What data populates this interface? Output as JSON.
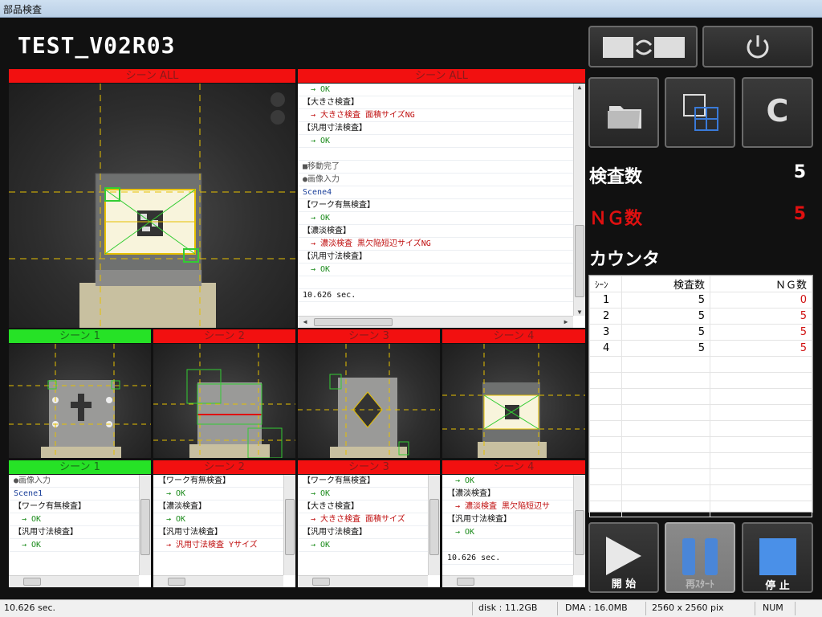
{
  "window": {
    "title": "部品検査"
  },
  "app": {
    "title": "TEST_V02R03"
  },
  "panels": {
    "top_left_header": "シーン ALL",
    "top_right_header": "シーン ALL",
    "scene_img_headers": [
      "シーン 1",
      "シーン 2",
      "シーン 3",
      "シーン 4"
    ],
    "scene_log_headers": [
      "シーン 1",
      "シーン 2",
      "シーン 3",
      "シーン 4"
    ]
  },
  "main_log": [
    "→ OK",
    "【大きさ検査】",
    "→ 大きさ検査 面積サイズNG",
    "【汎用寸法検査】",
    "→ OK",
    "",
    "■移動完了",
    "●画像入力",
    "Scene4",
    "【ワーク有無検査】",
    "→ OK",
    "【濃淡検査】",
    "→ 濃淡検査 黒欠陥短辺サイズNG",
    "【汎用寸法検査】",
    "→ OK",
    "",
    "10.626 sec."
  ],
  "scene_logs": [
    [
      "●画像入力",
      "Scene1",
      "【ワーク有無検査】",
      "→ OK",
      "【汎用寸法検査】",
      "→ OK"
    ],
    [
      "【ワーク有無検査】",
      "→ OK",
      "【濃淡検査】",
      "→ OK",
      "【汎用寸法検査】",
      "→ 汎用寸法検査 Yサイズ"
    ],
    [
      "【ワーク有無検査】",
      "→ OK",
      "【大きさ検査】",
      "→ 大きさ検査 面積サイズ",
      "【汎用寸法検査】",
      "→ OK"
    ],
    [
      "→ OK",
      "【濃淡検査】",
      "→ 濃淡検査 黒欠陥短辺サ",
      "【汎用寸法検査】",
      "→ OK",
      "",
      "10.626 sec."
    ]
  ],
  "stats": {
    "inspect_label": "検査数",
    "inspect_value": "5",
    "ng_label": "ＮＧ数",
    "ng_value": "5",
    "counter_label": "カウンタ"
  },
  "counter_table": {
    "headers": [
      "ｼｰﾝ",
      "検査数",
      "ＮＧ数"
    ],
    "rows": [
      [
        "1",
        "5",
        "0"
      ],
      [
        "2",
        "5",
        "5"
      ],
      [
        "3",
        "5",
        "5"
      ],
      [
        "4",
        "5",
        "5"
      ]
    ]
  },
  "buttons": {
    "start": "開 始",
    "restart": "再ｽﾀｰﾄ",
    "stop": "停 止",
    "clear": "C"
  },
  "status": {
    "time": "10.626 sec.",
    "disk": "disk : 11.2GB",
    "dma": "DMA : 16.0MB",
    "resolution": "2560 x 2560 pix",
    "num": "NUM"
  },
  "colors": {
    "ng": "#f21010",
    "ok": "#26e226",
    "ng_text": "#d01010"
  }
}
